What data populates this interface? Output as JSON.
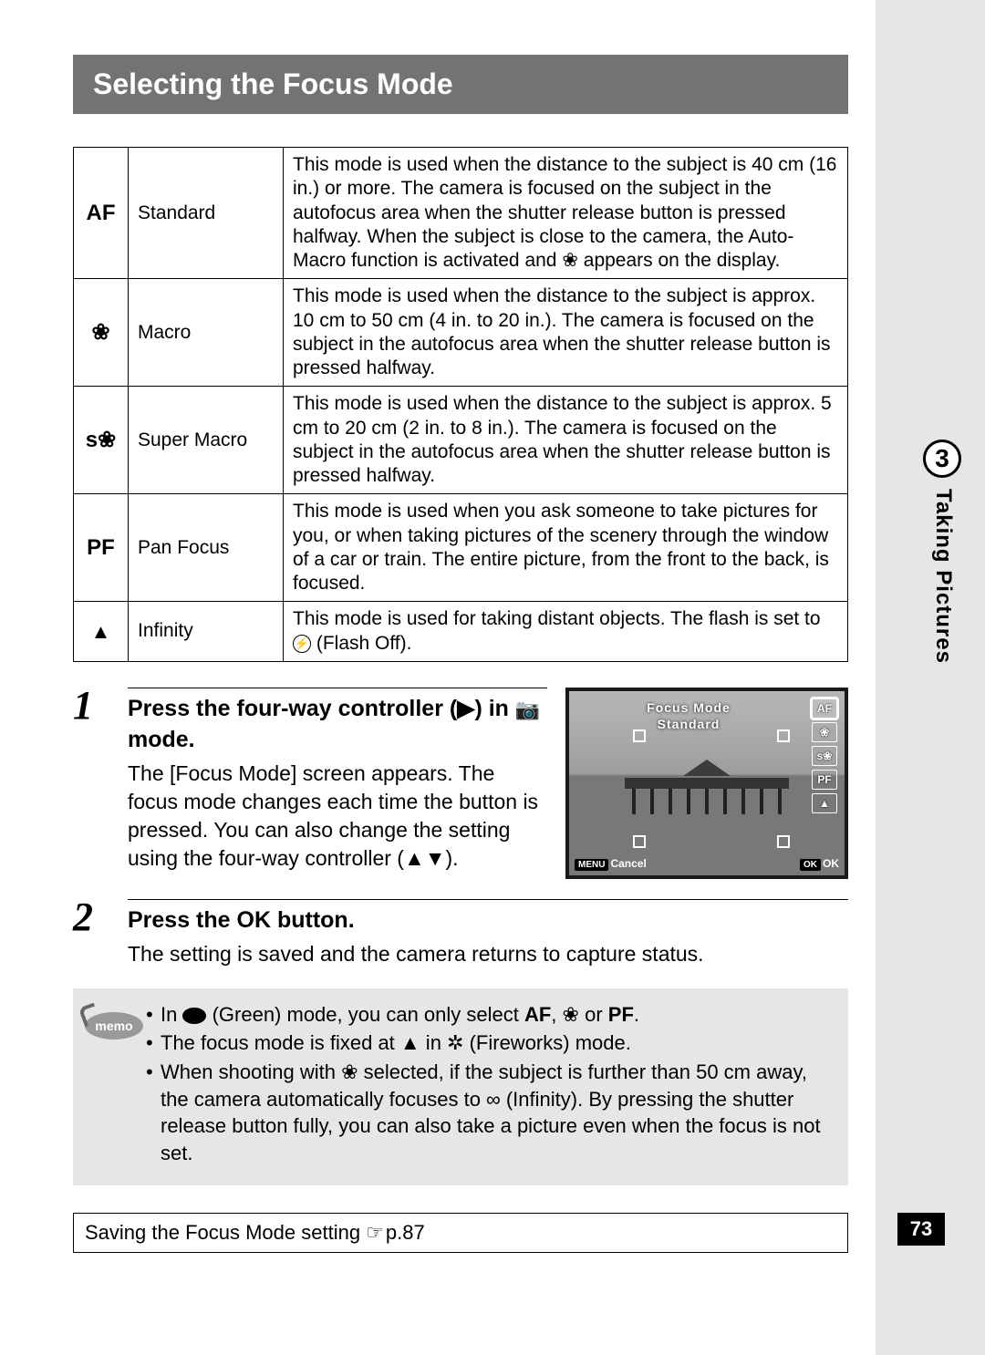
{
  "title": "Selecting the Focus Mode",
  "chapter_number": "3",
  "chapter_label": "Taking Pictures",
  "page_number": "73",
  "modes": [
    {
      "icon": "AF",
      "icon_class": "icon-af",
      "name": "Standard",
      "desc_pre": "This mode is used when the distance to the subject is 40 cm (16 in.) or more. The camera is focused on the subject in the autofocus area when the shutter release button is pressed halfway. When the subject is close to the camera, the Auto-Macro function is activated and ",
      "desc_post": " appears on the display."
    },
    {
      "icon": "❀",
      "icon_class": "flower",
      "name": "Macro",
      "desc_pre": "This mode is used when the distance to the subject is approx. 10 cm to 50 cm (4 in. to 20 in.). The camera is focused on the subject in the autofocus area when the shutter release button is pressed halfway.",
      "desc_post": ""
    },
    {
      "icon": "s❀",
      "icon_class": "flower",
      "name": "Super Macro",
      "desc_pre": "This mode is used when the distance to the subject is approx. 5 cm to 20 cm (2 in. to 8 in.). The camera is focused on the subject in the autofocus area when the shutter release button is pressed halfway.",
      "desc_post": ""
    },
    {
      "icon": "PF",
      "icon_class": "icon-pf",
      "name": "Pan Focus",
      "desc_pre": "This mode is used when you ask someone to take pictures for you, or when taking pictures of the scenery through the window of a car or train. The entire picture, from the front to the back, is focused.",
      "desc_post": ""
    },
    {
      "icon": "▲",
      "icon_class": "mtn",
      "name": "Infinity",
      "desc_pre": "This mode is used for taking distant objects. The flash is set to ",
      "desc_mid_icon": "flash-off",
      "desc_post": " (Flash Off)."
    }
  ],
  "step1": {
    "head_a": "Press the four-way controller (",
    "head_b": ") in ",
    "head_c": " mode.",
    "body": "The [Focus Mode] screen appears. The focus mode changes each time the button is pressed. You can also change the setting using the four-way controller (▲▼)."
  },
  "lcd": {
    "title1": "Focus Mode",
    "title2": "Standard",
    "icons": [
      "AF",
      "❀",
      "s❀",
      "PF",
      "▲"
    ],
    "menu_btn": "MENU",
    "menu_cancel": "Cancel",
    "ok_btn": "OK",
    "ok_label": "OK"
  },
  "step2": {
    "head_a": "Press the ",
    "head_b": " button.",
    "body": "The setting is saved and the camera returns to capture status."
  },
  "memo_label": "memo",
  "memo": {
    "line1_a": "In ",
    "line1_b": " (Green) mode, you can only select ",
    "line1_c": ", ",
    "line1_d": " or ",
    "line1_e": ".",
    "line2_a": "The focus mode is fixed at ",
    "line2_b": " in ",
    "line2_c": " (Fireworks) mode.",
    "line3_a": "When shooting with ",
    "line3_b": " selected, if the subject is further than 50 cm away, the camera automatically focuses to ∞ (Infinity). By pressing the shutter release button fully, you can also take a picture even when the focus is not set."
  },
  "ref": {
    "text": "Saving the Focus Mode setting ",
    "pointer": "☞",
    "page": "p.87"
  },
  "glyphs": {
    "right_tri": "▶",
    "camera": "◉",
    "ok": "OK",
    "af": "AF",
    "flower": "❀",
    "pf": "PF",
    "mtn": "▲",
    "fireworks": "✲"
  }
}
